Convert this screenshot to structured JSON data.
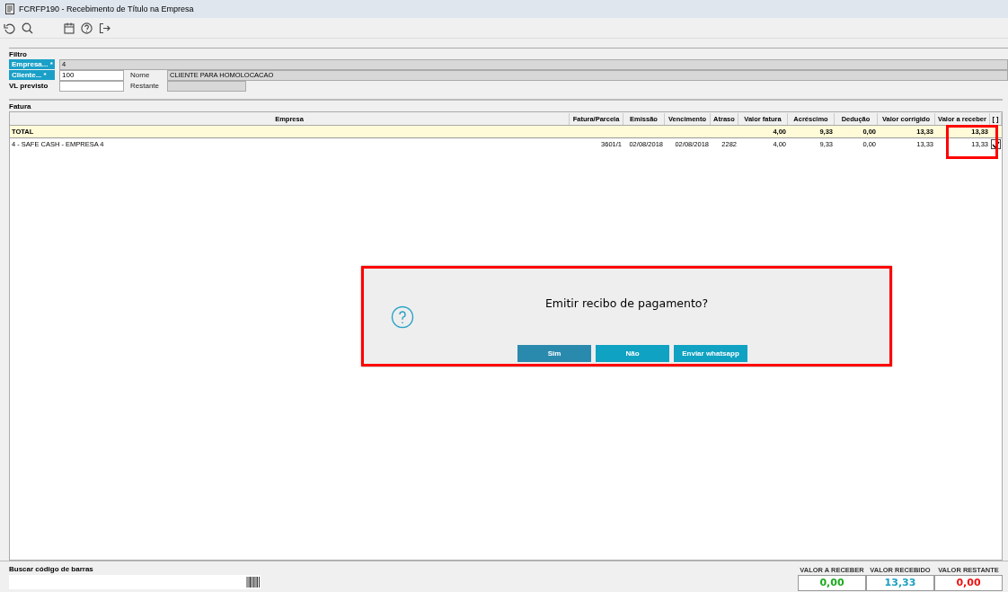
{
  "window": {
    "title": "FCRFP190 - Recebimento de Título na Empresa"
  },
  "filter": {
    "title": "Filtro",
    "empresa": {
      "label": "Empresa... *",
      "value": "4"
    },
    "cliente": {
      "label": "Cliente... *",
      "value": "100",
      "name_label": "Nome",
      "name_value": "CLIENTE PARA HOMOLOCACAO"
    },
    "previsto": {
      "label": "VL previsto",
      "restante_label": "Restante"
    }
  },
  "fatura": {
    "title": "Fatura",
    "columns": [
      "Empresa",
      "Fatura/Parcela",
      "Emissão",
      "Vencimento",
      "Atraso",
      "Valor fatura",
      "Acréscimo",
      "Dedução",
      "Valor corrigido",
      "Valor a receber",
      "[ ]"
    ],
    "total": {
      "label": "TOTAL",
      "values": [
        "4,00",
        "9,33",
        "0,00",
        "13,33",
        "13,33"
      ]
    },
    "rows": [
      {
        "cells": [
          "4 - SAFE CASH -  EMPRESA 4",
          "3601/1",
          "02/08/2018",
          "02/08/2018",
          "2282",
          "4,00",
          "9,33",
          "0,00",
          "13,33",
          "13,33"
        ],
        "checked": true
      }
    ]
  },
  "dialog": {
    "message": "Emitir recibo de pagamento?",
    "buttons": [
      "Sim",
      "Não",
      "Enviar whatsapp"
    ]
  },
  "barcode": {
    "label": "Buscar código de barras"
  },
  "summary": [
    {
      "label": "VALOR A RECEBER",
      "value": "0,00",
      "color": "#1aaa1a"
    },
    {
      "label": "VALOR RECEBIDO",
      "value": "13,33",
      "color": "#1a9fc0"
    },
    {
      "label": "VALOR RESTANTE",
      "value": "0,00",
      "color": "#ee1111"
    }
  ]
}
